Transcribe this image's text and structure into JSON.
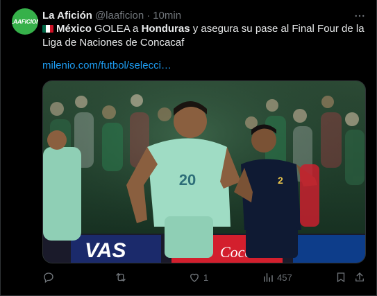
{
  "tweet": {
    "author_name": "La Afición",
    "author_handle": "@laaficion",
    "separator": "·",
    "timestamp": "10min",
    "avatar_text": "LAAFICION",
    "body": {
      "flag_emoji": "mexico-flag-icon",
      "part1": "México",
      "part2": " GOLEA a ",
      "part3": "Honduras",
      "part4": " y asegura su pase al Final Four de la Liga de Naciones de Concacaf"
    },
    "link_text": "milenio.com/futbol/selecci…",
    "media": {
      "alt": "Mexico player celebrating goal with number 20 jersey",
      "player_number_front": "20",
      "opponent_number": "2",
      "ad_board_left": "VAS",
      "ad_board_right": "Coca"
    }
  },
  "actions": {
    "reply_count": "",
    "retweet_count": "",
    "like_count": "1",
    "views_count": "457"
  },
  "colors": {
    "accent": "#1d9bf0",
    "muted": "#71767b",
    "text": "#e7e9ea",
    "background": "#000000",
    "avatar_bg": "#36b14a"
  }
}
